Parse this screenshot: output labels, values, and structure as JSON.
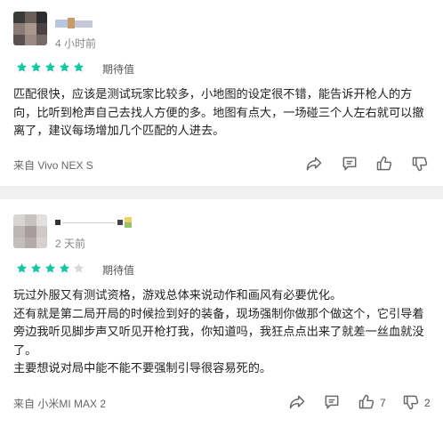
{
  "reviews": [
    {
      "time": "4 小时前",
      "rating": 5,
      "rating_label": "期待值",
      "body": [
        "匹配很快，应该是测试玩家比较多，小地图的设定很不错，能告诉开枪人的方向，比听到枪声自己去找人方便的多。地图有点大，一场碰三个人左右就可以撤离了，建议每场增加几个匹配的人进去。"
      ],
      "device": "来自 Vivo NEX S",
      "like_count": "",
      "dislike_count": ""
    },
    {
      "time": "2 天前",
      "rating": 4,
      "rating_label": "期待值",
      "body": [
        "玩过外服又有测试资格，游戏总体来说动作和画风有必要优化。",
        "还有就是第二局开局的时候捡到好的装备，现场强制你做那个做这个，它引导着旁边我听见脚步声又听见开枪打我，你知道吗，我狂点点出来了就差一丝血就没了。",
        "主要想说对局中能不能不要强制引导很容易死的。"
      ],
      "device": "来自 小米MI MAX 2",
      "like_count": "7",
      "dislike_count": "2"
    }
  ],
  "colors": {
    "star_on": "#19c4a4",
    "star_off": "#d9d9d9",
    "icon": "#6a6a6a"
  },
  "icons": [
    "share-icon",
    "comment-icon",
    "thumbs-up-icon",
    "thumbs-down-icon"
  ]
}
